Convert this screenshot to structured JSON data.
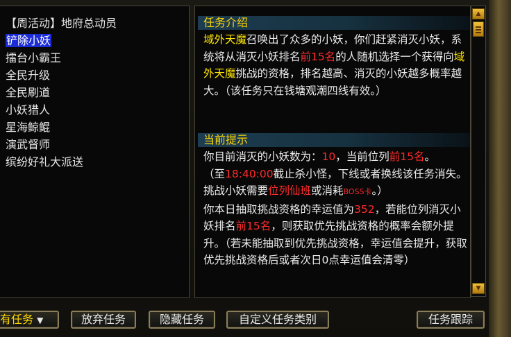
{
  "quest_list": {
    "items": [
      {
        "label": "【周活动】地府总动员",
        "selected": false
      },
      {
        "label": "铲除小妖",
        "selected": true
      },
      {
        "label": "擂台小霸王",
        "selected": false
      },
      {
        "label": "全民升级",
        "selected": false
      },
      {
        "label": "全民刷道",
        "selected": false
      },
      {
        "label": "小妖猎人",
        "selected": false
      },
      {
        "label": "星海鲸鲲",
        "selected": false
      },
      {
        "label": "演武督师",
        "selected": false
      },
      {
        "label": "缤纷好礼大派送",
        "selected": false
      }
    ]
  },
  "details": {
    "intro_title": "任务介绍",
    "intro": {
      "boss1": "域外天魔",
      "t1": "召唤出了众多的小妖，你们赶紧消灭小妖，系统将从消灭小妖排名",
      "rank": "前15名",
      "t2": "的人随机选择一个获得向",
      "boss2": "域外天魔",
      "t3": "挑战的资格，排名越高、消灭的小妖越多概率越大。（该任务只在钱塘观潮四线有效。）"
    },
    "hint_title": "当前提示",
    "hint": {
      "a1": "你目前消灭的小妖数为：",
      "kills": "10",
      "a2": "，当前位列",
      "rank": "前15名",
      "a3": "。",
      "b1": "（至",
      "time": "18:40:00",
      "b2": "截止杀小怪，下线或者换线该任务消失。挑战小妖需要",
      "req": "位列仙班",
      "b3": "或消耗",
      "boss_card": "BOSS卡",
      "b4": "。）",
      "c1": "你本日抽取挑战资格的幸运值为",
      "luck": "352",
      "c2": "，若能位列消灭小妖排名",
      "rank2": "前15名",
      "c3": "，则获取优先挑战资格的概率会额外提升。（若未能抽取到优先挑战资格，幸运值会提升，获取优先挑战资格后或者次日0点幸运值会清零）"
    }
  },
  "buttons": {
    "filter": "有任务",
    "abandon": "放弃任务",
    "hide": "隐藏任务",
    "custom": "自定义任务类别",
    "track": "任务跟踪"
  },
  "colors": {
    "highlight_yellow": "#ffe600",
    "highlight_red": "#ff2a2a",
    "selection_blue": "#1b2cd6",
    "title_gold": "#ffd700"
  },
  "icons": {
    "scroll_up": "triangle-up-icon",
    "scroll_down": "triangle-down-icon",
    "dropdown": "chevron-down-icon"
  }
}
